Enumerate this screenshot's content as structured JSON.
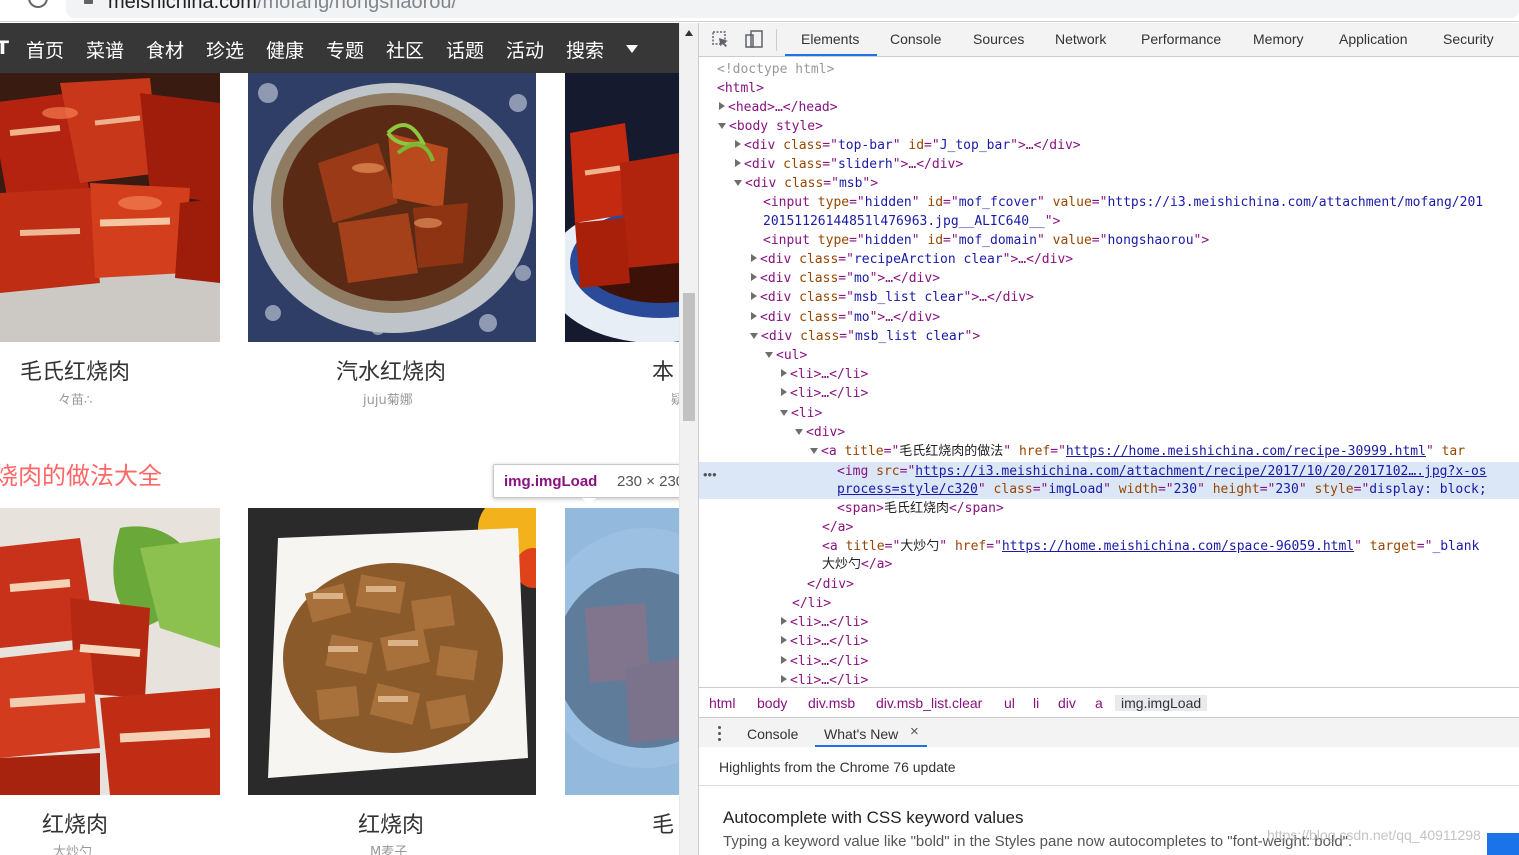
{
  "browser": {
    "url_domain": "meishichina.com",
    "url_path": "/mofang/hongshaorou/"
  },
  "nav": {
    "logo": "T",
    "items": [
      "首页",
      "菜谱",
      "食材",
      "珍选",
      "健康",
      "专题",
      "社区",
      "话题",
      "活动",
      "搜索"
    ]
  },
  "recipes_row1": [
    {
      "title": "毛氏红烧肉",
      "author": "々苗∴"
    },
    {
      "title": "汽水红烧肉",
      "author": "juju菊娜"
    },
    {
      "title": "本",
      "author": "疑"
    }
  ],
  "section_title": "烧肉的做法大全",
  "recipes_row2": [
    {
      "title": "红烧肉",
      "author": "大炒勺"
    },
    {
      "title": "红烧肉",
      "author": "M麦子"
    },
    {
      "title": "毛",
      "author": ""
    }
  ],
  "tooltip": {
    "tag": "img.imgLoad",
    "size": "230 × 230"
  },
  "devtools": {
    "tabs": [
      "Elements",
      "Console",
      "Sources",
      "Network",
      "Performance",
      "Memory",
      "Application",
      "Security"
    ],
    "active_tab": "Elements",
    "tree": {
      "l0": "<!doctype html>",
      "l1_open": "<html>",
      "l2_head": "<head>…</head>",
      "l3_body_open": "<body style>",
      "l4_topbar": [
        {
          "k": "tg",
          "v": "<div "
        },
        {
          "k": "at",
          "v": "class"
        },
        {
          "k": "tg",
          "v": "=\""
        },
        {
          "k": "av",
          "v": "top-bar"
        },
        {
          "k": "tg",
          "v": "\" "
        },
        {
          "k": "at",
          "v": "id"
        },
        {
          "k": "tg",
          "v": "=\""
        },
        {
          "k": "av",
          "v": "J_top_bar"
        },
        {
          "k": "tg",
          "v": "\">…</div>"
        }
      ],
      "l5_sliderh": [
        {
          "k": "tg",
          "v": "<div "
        },
        {
          "k": "at",
          "v": "class"
        },
        {
          "k": "tg",
          "v": "=\""
        },
        {
          "k": "av",
          "v": "sliderh"
        },
        {
          "k": "tg",
          "v": "\">…</div>"
        }
      ],
      "l6_msb": [
        {
          "k": "tg",
          "v": "<div "
        },
        {
          "k": "at",
          "v": "class"
        },
        {
          "k": "tg",
          "v": "=\""
        },
        {
          "k": "av",
          "v": "msb"
        },
        {
          "k": "tg",
          "v": "\">"
        }
      ],
      "l7_input1": [
        {
          "k": "tg",
          "v": "<input "
        },
        {
          "k": "at",
          "v": "type"
        },
        {
          "k": "tg",
          "v": "=\""
        },
        {
          "k": "av",
          "v": "hidden"
        },
        {
          "k": "tg",
          "v": "\" "
        },
        {
          "k": "at",
          "v": "id"
        },
        {
          "k": "tg",
          "v": "=\""
        },
        {
          "k": "av",
          "v": "mof_fcover"
        },
        {
          "k": "tg",
          "v": "\" "
        },
        {
          "k": "at",
          "v": "value"
        },
        {
          "k": "tg",
          "v": "=\""
        },
        {
          "k": "av",
          "v": "https://i3.meishichina.com/attachment/mofang/201"
        }
      ],
      "l7b_input1_cont": [
        {
          "k": "av",
          "v": "20151126144851l476963.jpg__ALIC640__"
        },
        {
          "k": "tg",
          "v": "\">"
        }
      ],
      "l8_input2": [
        {
          "k": "tg",
          "v": "<input "
        },
        {
          "k": "at",
          "v": "type"
        },
        {
          "k": "tg",
          "v": "=\""
        },
        {
          "k": "av",
          "v": "hidden"
        },
        {
          "k": "tg",
          "v": "\" "
        },
        {
          "k": "at",
          "v": "id"
        },
        {
          "k": "tg",
          "v": "=\""
        },
        {
          "k": "av",
          "v": "mof_domain"
        },
        {
          "k": "tg",
          "v": "\" "
        },
        {
          "k": "at",
          "v": "value"
        },
        {
          "k": "tg",
          "v": "=\""
        },
        {
          "k": "av",
          "v": "hongshaorou"
        },
        {
          "k": "tg",
          "v": "\">"
        }
      ],
      "l9_recipe": [
        {
          "k": "tg",
          "v": "<div "
        },
        {
          "k": "at",
          "v": "class"
        },
        {
          "k": "tg",
          "v": "=\""
        },
        {
          "k": "av",
          "v": "recipeArction clear"
        },
        {
          "k": "tg",
          "v": "\">…</div>"
        }
      ],
      "l10_mo": [
        {
          "k": "tg",
          "v": "<div "
        },
        {
          "k": "at",
          "v": "class"
        },
        {
          "k": "tg",
          "v": "=\""
        },
        {
          "k": "av",
          "v": "mo"
        },
        {
          "k": "tg",
          "v": "\">…</div>"
        }
      ],
      "l11_list": [
        {
          "k": "tg",
          "v": "<div "
        },
        {
          "k": "at",
          "v": "class"
        },
        {
          "k": "tg",
          "v": "=\""
        },
        {
          "k": "av",
          "v": "msb_list clear"
        },
        {
          "k": "tg",
          "v": "\">…</div>"
        }
      ],
      "l12_mo": [
        {
          "k": "tg",
          "v": "<div "
        },
        {
          "k": "at",
          "v": "class"
        },
        {
          "k": "tg",
          "v": "=\""
        },
        {
          "k": "av",
          "v": "mo"
        },
        {
          "k": "tg",
          "v": "\">…</div>"
        }
      ],
      "l13_list_open": [
        {
          "k": "tg",
          "v": "<div "
        },
        {
          "k": "at",
          "v": "class"
        },
        {
          "k": "tg",
          "v": "=\""
        },
        {
          "k": "av",
          "v": "msb_list clear"
        },
        {
          "k": "tg",
          "v": "\">"
        }
      ],
      "l14_ul": [
        {
          "k": "tg",
          "v": "<ul>"
        }
      ],
      "l15_li": [
        {
          "k": "tg",
          "v": "<li>…</li>"
        }
      ],
      "l16_li": [
        {
          "k": "tg",
          "v": "<li>…</li>"
        }
      ],
      "l17_li_open": [
        {
          "k": "tg",
          "v": "<li>"
        }
      ],
      "l18_div": [
        {
          "k": "tg",
          "v": "<div>"
        }
      ],
      "l19_a": [
        {
          "k": "tg",
          "v": "<a "
        },
        {
          "k": "at",
          "v": "title"
        },
        {
          "k": "tg",
          "v": "=\""
        },
        {
          "k": "tx",
          "v": "毛氏红烧肉的做法"
        },
        {
          "k": "tg",
          "v": "\" "
        },
        {
          "k": "at",
          "v": "href"
        },
        {
          "k": "tg",
          "v": "=\""
        },
        {
          "k": "lk",
          "v": "https://home.meishichina.com/recipe-30999.html"
        },
        {
          "k": "tg",
          "v": "\" "
        },
        {
          "k": "at",
          "v": "tar"
        }
      ],
      "l20_img": [
        {
          "k": "tg",
          "v": "<img "
        },
        {
          "k": "at",
          "v": "src"
        },
        {
          "k": "tg",
          "v": "=\""
        },
        {
          "k": "lk",
          "v": "https://i3.meishichina.com/attachment/recipe/2017/10/20/2017102….jpg?x-os"
        }
      ],
      "l20b_img_cont": [
        {
          "k": "lk",
          "v": "process=style/c320"
        },
        {
          "k": "tg",
          "v": "\" "
        },
        {
          "k": "at",
          "v": "class"
        },
        {
          "k": "tg",
          "v": "=\""
        },
        {
          "k": "av",
          "v": "imgLoad"
        },
        {
          "k": "tg",
          "v": "\" "
        },
        {
          "k": "at",
          "v": "width"
        },
        {
          "k": "tg",
          "v": "=\""
        },
        {
          "k": "av",
          "v": "230"
        },
        {
          "k": "tg",
          "v": "\" "
        },
        {
          "k": "at",
          "v": "height"
        },
        {
          "k": "tg",
          "v": "=\""
        },
        {
          "k": "av",
          "v": "230"
        },
        {
          "k": "tg",
          "v": "\" "
        },
        {
          "k": "at",
          "v": "style"
        },
        {
          "k": "tg",
          "v": "=\""
        },
        {
          "k": "av",
          "v": "display: block;"
        }
      ],
      "l21_span": [
        {
          "k": "tg",
          "v": "<span>"
        },
        {
          "k": "tx",
          "v": "毛氏红烧肉"
        },
        {
          "k": "tg",
          "v": "</span>"
        }
      ],
      "l22_a_close": [
        {
          "k": "tg",
          "v": "</a>"
        }
      ],
      "l23_a2": [
        {
          "k": "tg",
          "v": "<a "
        },
        {
          "k": "at",
          "v": "title"
        },
        {
          "k": "tg",
          "v": "=\""
        },
        {
          "k": "tx",
          "v": "大炒勺"
        },
        {
          "k": "tg",
          "v": "\" "
        },
        {
          "k": "at",
          "v": "href"
        },
        {
          "k": "tg",
          "v": "=\""
        },
        {
          "k": "lk",
          "v": "https://home.meishichina.com/space-96059.html"
        },
        {
          "k": "tg",
          "v": "\" "
        },
        {
          "k": "at",
          "v": "target"
        },
        {
          "k": "tg",
          "v": "=\""
        },
        {
          "k": "av",
          "v": "_blank"
        }
      ],
      "l23b_text": [
        {
          "k": "tx",
          "v": "大炒勺"
        },
        {
          "k": "tg",
          "v": "</a>"
        }
      ],
      "l24_div_close": [
        {
          "k": "tg",
          "v": "</div>"
        }
      ],
      "l25_li_close": [
        {
          "k": "tg",
          "v": "</li>"
        }
      ],
      "l26_li": [
        {
          "k": "tg",
          "v": "<li>…</li>"
        }
      ],
      "l27_li": [
        {
          "k": "tg",
          "v": "<li>…</li>"
        }
      ],
      "l28_li": [
        {
          "k": "tg",
          "v": "<li>…</li>"
        }
      ],
      "l29_li": [
        {
          "k": "tg",
          "v": "<li>…</li>"
        }
      ]
    },
    "dots": "•••",
    "breadcrumbs": [
      "html",
      "body",
      "div.msb",
      "div.msb_list.clear",
      "ul",
      "li",
      "div",
      "a",
      "img.imgLoad"
    ],
    "drawer": {
      "tab1": "Console",
      "tab2": "What's New",
      "close": "×"
    },
    "whatsnew": {
      "header": "Highlights from the Chrome 76 update",
      "title": "Autocomplete with CSS keyword values",
      "desc": "Typing a keyword value like \"bold\" in the Styles pane now autocompletes to \"font-weight: bold\".",
      "watermark": "https://blog.csdn.net/qq_40911298"
    }
  },
  "colors": {
    "nav_bg": "#373737",
    "section_title": "#ff6767",
    "tag": "#881280",
    "attr": "#994500",
    "value": "#1a1aa6",
    "selected_row": "#dbe6f6",
    "accent": "#1a73e8"
  }
}
